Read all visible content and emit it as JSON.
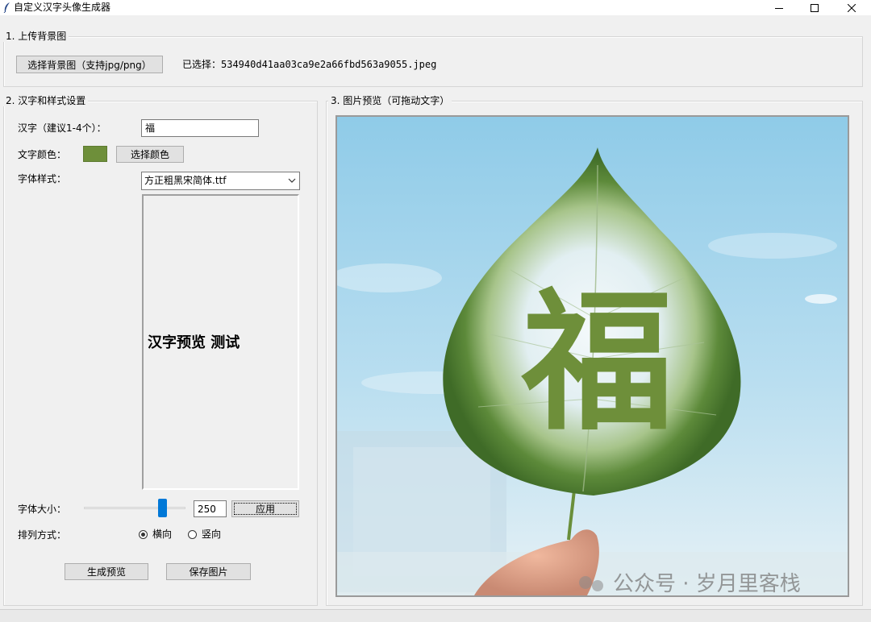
{
  "window": {
    "title": "自定义汉字头像生成器",
    "controls": {
      "minimize": "─",
      "maximize": "☐",
      "close": "✕"
    }
  },
  "upload": {
    "group_label": "1. 上传背景图",
    "button_label": "选择背景图（支持jpg/png）",
    "selected_text": "已选择：534940d41aa03ca9e2a66fbd563a9055.jpeg"
  },
  "settings": {
    "group_label": "2. 汉字和样式设置",
    "hanzi_label": "汉字（建议1-4个）：",
    "hanzi_value": "福",
    "color_label": "文字颜色：",
    "color_value": "#6e8f3a",
    "color_button": "选择颜色",
    "font_label": "字体样式：",
    "font_selected": "方正粗黑宋简体.ttf",
    "font_preview_text": "汉字预览 测试",
    "size_label": "字体大小：",
    "size_value": "250",
    "size_slider_fraction": 0.74,
    "apply_button": "应用",
    "layout_label": "排列方式：",
    "layout_options": [
      "横向",
      "竖向"
    ],
    "layout_selected": "横向",
    "generate_button": "生成预览",
    "save_button": "保存图片"
  },
  "preview": {
    "group_label": "3. 图片预览（可拖动文字）",
    "overlay_char": "福",
    "overlay_color": "#6e8f3a",
    "watermark": "公众号 · 岁月里客栈"
  }
}
